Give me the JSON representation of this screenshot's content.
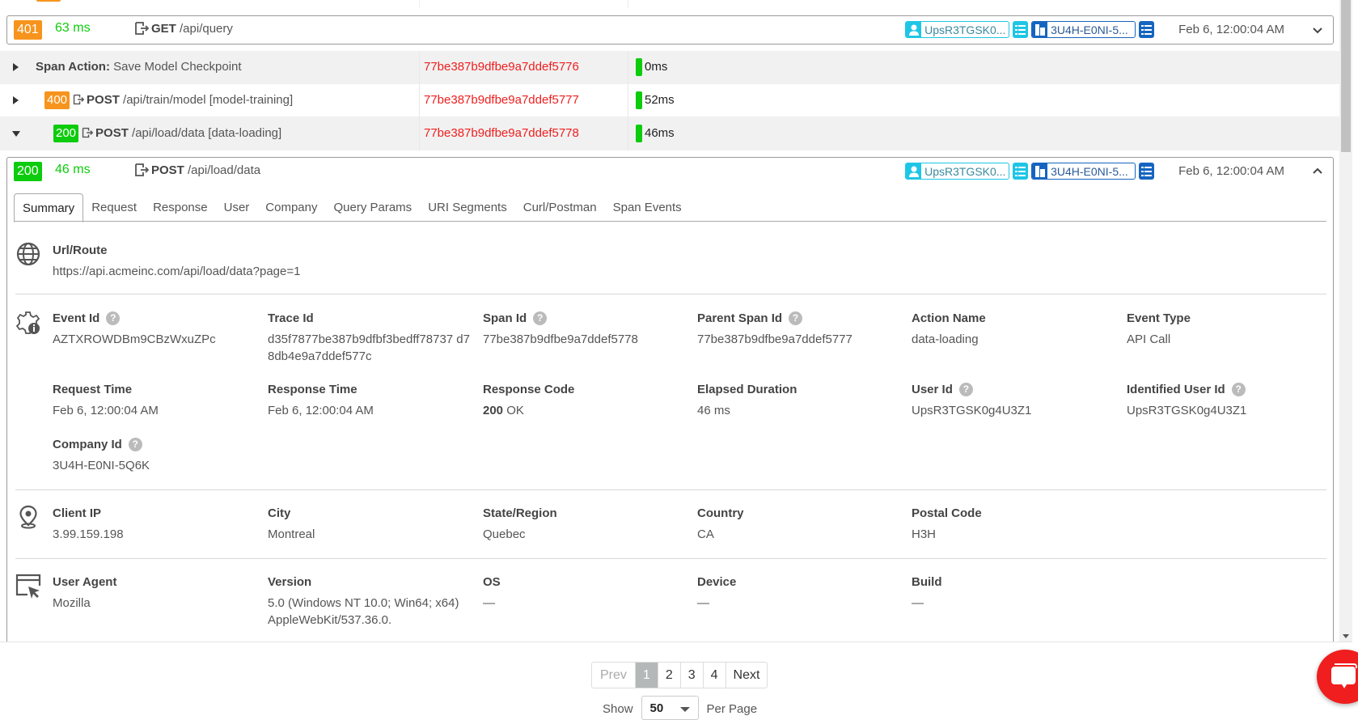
{
  "top_event": {
    "status": "401",
    "status_color": "#f7941d",
    "duration": "63 ms",
    "method": "GET",
    "path": "/api/query",
    "user_chip": "UpsR3TGSK0...",
    "company_chip": "3U4H-E0NI-5...",
    "timestamp": "Feb 6, 12:00:04 AM",
    "expanded": false
  },
  "span_rows": [
    {
      "label_bold": "Span Action:",
      "label": " Save Model Checkpoint",
      "status": "",
      "method": "",
      "span_id": "77be387b9dfbe9a7ddef5776",
      "duration": "0ms",
      "expanded": false
    },
    {
      "label_bold": "POST",
      "label": " /api/train/model [model-training]",
      "status": "400",
      "method": "POST",
      "span_id": "77be387b9dfbe9a7ddef5777",
      "duration": "52ms",
      "expanded": false
    },
    {
      "label_bold": "POST",
      "label": " /api/load/data [data-loading]",
      "status": "200",
      "method": "POST",
      "span_id": "77be387b9dfbe9a7ddef5778",
      "duration": "46ms",
      "expanded": true
    }
  ],
  "detail_event": {
    "status": "200",
    "duration": "46 ms",
    "method": "POST",
    "path": "/api/load/data",
    "user_chip": "UpsR3TGSK0...",
    "company_chip": "3U4H-E0NI-5...",
    "timestamp": "Feb 6, 12:00:04 AM",
    "tabs": [
      "Summary",
      "Request",
      "Response",
      "User",
      "Company",
      "Query Params",
      "URI Segments",
      "Curl/Postman",
      "Span Events"
    ],
    "active_tab": "Summary",
    "url_route": {
      "label": "Url/Route",
      "value": "https://api.acmeinc.com/api/load/data?page=1"
    },
    "event_fields": {
      "event_id": {
        "label": "Event Id",
        "value": "AZTXROWDBm9CBzWxuZPc"
      },
      "trace_id": {
        "label": "Trace Id",
        "value": "d35f7877be387b9dfbf3bedff78737 d78db4e9a7ddef577c"
      },
      "span_id": {
        "label": "Span Id",
        "value": "77be387b9dfbe9a7ddef5778"
      },
      "parent_span_id": {
        "label": "Parent Span Id",
        "value": "77be387b9dfbe9a7ddef5777"
      },
      "action_name": {
        "label": "Action Name",
        "value": "data-loading"
      },
      "event_type": {
        "label": "Event Type",
        "value": "API Call"
      },
      "request_time": {
        "label": "Request Time",
        "value": "Feb 6, 12:00:04 AM"
      },
      "response_time": {
        "label": "Response Time",
        "value": "Feb 6, 12:00:04 AM"
      },
      "response_code": {
        "label": "Response Code",
        "code": "200",
        "text": " OK"
      },
      "elapsed_duration": {
        "label": "Elapsed Duration",
        "value": "46 ms"
      },
      "user_id": {
        "label": "User Id",
        "value": "UpsR3TGSK0g4U3Z1"
      },
      "identified_user_id": {
        "label": "Identified User Id",
        "value": "UpsR3TGSK0g4U3Z1"
      },
      "company_id": {
        "label": "Company Id",
        "value": "3U4H-E0NI-5Q6K"
      }
    },
    "location": {
      "client_ip": {
        "label": "Client IP",
        "value": "3.99.159.198"
      },
      "city": {
        "label": "City",
        "value": "Montreal"
      },
      "state": {
        "label": "State/Region",
        "value": "Quebec"
      },
      "country": {
        "label": "Country",
        "value": "CA"
      },
      "postal": {
        "label": "Postal Code",
        "value": "H3H"
      }
    },
    "agent": {
      "user_agent": {
        "label": "User Agent",
        "value": "Mozilla"
      },
      "version": {
        "label": "Version",
        "value": "5.0 (Windows NT 10.0; Win64; x64) AppleWebKit/537.36.0."
      },
      "os": {
        "label": "OS",
        "value": "—"
      },
      "device": {
        "label": "Device",
        "value": "—"
      },
      "build": {
        "label": "Build",
        "value": "—"
      }
    }
  },
  "pagination": {
    "prev": "Prev",
    "pages": [
      "1",
      "2",
      "3",
      "4"
    ],
    "current": "1",
    "next": "Next",
    "show_label": "Show",
    "per_page_value": "50",
    "per_page_label": "Per Page"
  },
  "colors": {
    "success": "#0dcc0d",
    "warning": "#f7941d",
    "span_id": "#f01e1e",
    "user_chip": "#1ec6e6",
    "company_chip": "#1565c0",
    "chat": "#f01e1e"
  }
}
